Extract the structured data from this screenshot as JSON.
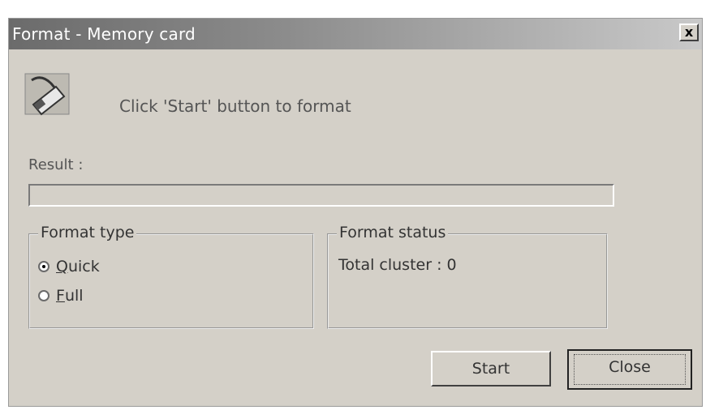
{
  "window": {
    "title": "Format - Memory card",
    "close_glyph": "x"
  },
  "prompt": "Click 'Start' button to format",
  "result_label": "Result :",
  "progress": {
    "value": 0
  },
  "format_type": {
    "legend": "Format type",
    "options": [
      {
        "accel": "Q",
        "rest": "uick",
        "selected": true
      },
      {
        "accel": "F",
        "rest": "ull",
        "selected": false
      }
    ]
  },
  "format_status": {
    "legend": "Format status",
    "total_cluster": "Total cluster : 0"
  },
  "buttons": {
    "start": "Start",
    "close": "Close"
  },
  "icons": {
    "format": "memory-card-format-icon"
  }
}
